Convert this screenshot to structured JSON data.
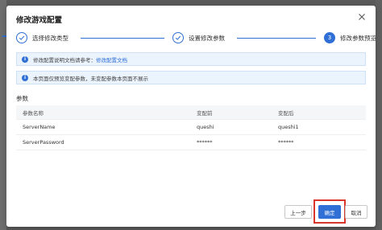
{
  "modal": {
    "title": "修改游戏配置"
  },
  "steps": [
    {
      "label": "选择修改类型",
      "state": "done"
    },
    {
      "label": "设置修改参数",
      "state": "done"
    },
    {
      "label": "修改参数预览",
      "state": "active",
      "number": "3"
    }
  ],
  "alerts": [
    {
      "text": "修改配置说明文档请参考：",
      "link": "修改配置文档"
    },
    {
      "text": "本页面仅预览变配参数，未变配参数本页面不展示"
    }
  ],
  "params": {
    "section_title": "参数",
    "columns": [
      "参数名称",
      "变配前",
      "变配后"
    ],
    "rows": [
      [
        "ServerName",
        "queshi",
        "queshi1"
      ],
      [
        "ServerPassword",
        "******",
        "******"
      ]
    ]
  },
  "footer": {
    "prev_label": "上一步",
    "ok_label": "确定",
    "cancel_label": "取消"
  },
  "colors": {
    "accent": "#2f6fd6",
    "highlight": "#d9372b",
    "alert_bg": "#ebf3fd"
  },
  "icons": {
    "close": "close-icon",
    "step_done": "check-icon",
    "alert": "info-icon"
  }
}
